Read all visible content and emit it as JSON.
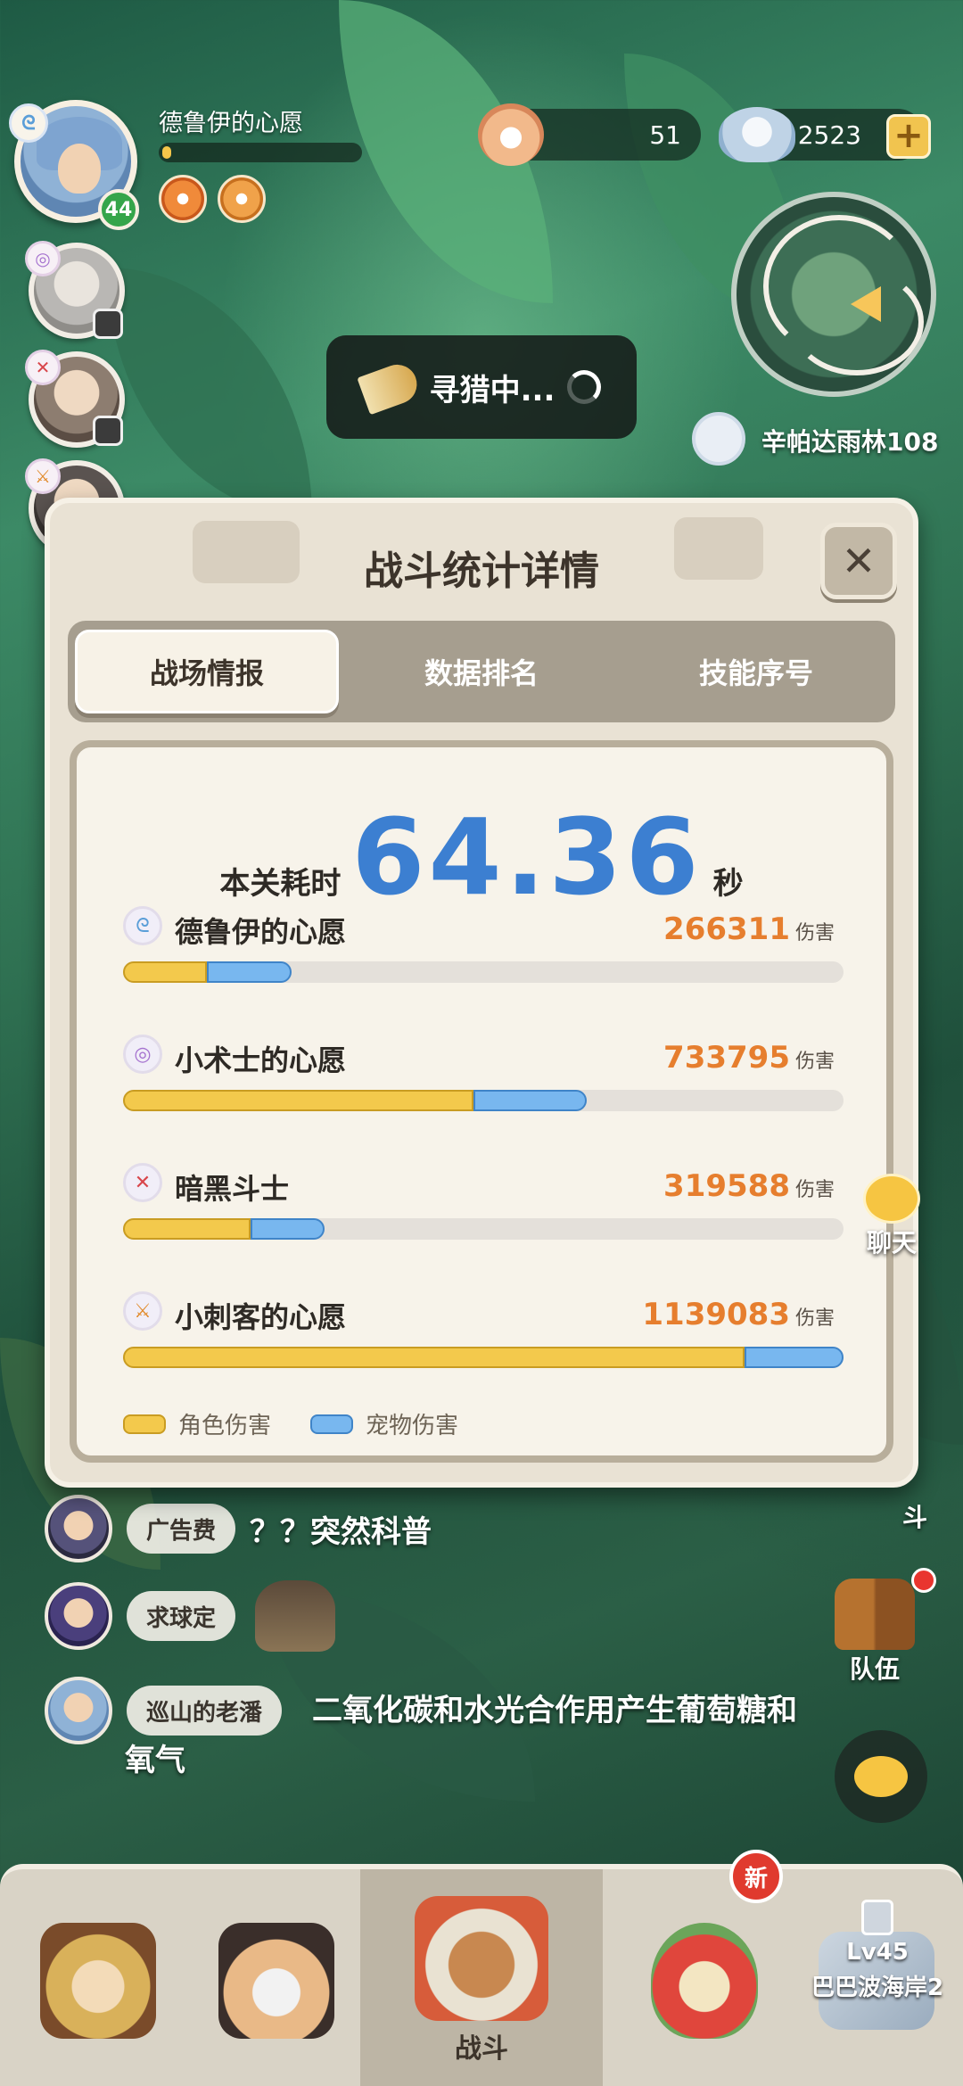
{
  "hud": {
    "player_name": "德鲁伊的心愿",
    "player_level": "44",
    "currency_shells": "51",
    "currency_gems": "2523",
    "add_icon": "+",
    "location": "辛帕达雨林108",
    "hunting_status": "寻猎中..."
  },
  "modal": {
    "title": "战斗统计详情",
    "close_icon": "✕",
    "tabs": [
      {
        "label": "战场情报",
        "active": true
      },
      {
        "label": "数据排名",
        "active": false
      },
      {
        "label": "技能序号",
        "active": false
      }
    ],
    "time_label": "本关耗时",
    "time_value": "64.36",
    "time_unit": "秒",
    "damage_unit": "伤害",
    "players": [
      {
        "name": "德鲁伊的心愿",
        "damage": "266311",
        "element_icon": "wind-icon",
        "role_fraction": 0.116,
        "pet_fraction": 0.118
      },
      {
        "name": "小术士的心愿",
        "damage": "733795",
        "element_icon": "arcane-icon",
        "role_fraction": 0.487,
        "pet_fraction": 0.157
      },
      {
        "name": "暗黑斗士",
        "damage": "319588",
        "element_icon": "crossed-swords-icon",
        "role_fraction": 0.177,
        "pet_fraction": 0.103
      },
      {
        "name": "小刺客的心愿",
        "damage": "1139083",
        "element_icon": "dagger-icon",
        "role_fraction": 0.863,
        "pet_fraction": 0.137
      }
    ],
    "legend": {
      "role": "角色伤害",
      "pet": "宠物伤害"
    },
    "colors": {
      "role": "#f3c94c",
      "pet": "#78b7ef",
      "time": "#3c7fd1",
      "damage": "#e67e2e"
    }
  },
  "chat": {
    "partial": {
      "name": "广告费",
      "text": "？？突然科普"
    },
    "messages": [
      {
        "name": "求球定",
        "text": ""
      },
      {
        "name": "巡山的老潘",
        "text": "二氧化碳和水光合作用产生葡萄糖和氧气"
      }
    ]
  },
  "side": {
    "chat_label": "聊天",
    "team_label": "队伍",
    "partial_label": "斗"
  },
  "nav": {
    "battle_label": "战斗",
    "new_badge": "新",
    "locked_level": "Lv45",
    "locked_area": "巴巴波海岸2"
  }
}
